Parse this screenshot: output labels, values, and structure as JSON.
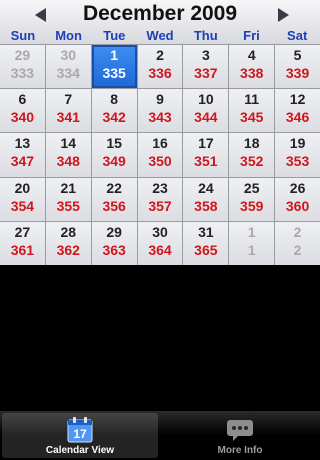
{
  "header": {
    "title": "December 2009",
    "prev_icon": "triangle-left",
    "next_icon": "triangle-right"
  },
  "weekdays": [
    "Sun",
    "Mon",
    "Tue",
    "Wed",
    "Thu",
    "Fri",
    "Sat"
  ],
  "weeks": [
    [
      {
        "day": "29",
        "doy": "333",
        "other": true
      },
      {
        "day": "30",
        "doy": "334",
        "other": true
      },
      {
        "day": "1",
        "doy": "335",
        "today": true
      },
      {
        "day": "2",
        "doy": "336"
      },
      {
        "day": "3",
        "doy": "337"
      },
      {
        "day": "4",
        "doy": "338"
      },
      {
        "day": "5",
        "doy": "339"
      }
    ],
    [
      {
        "day": "6",
        "doy": "340"
      },
      {
        "day": "7",
        "doy": "341"
      },
      {
        "day": "8",
        "doy": "342"
      },
      {
        "day": "9",
        "doy": "343"
      },
      {
        "day": "10",
        "doy": "344"
      },
      {
        "day": "11",
        "doy": "345"
      },
      {
        "day": "12",
        "doy": "346"
      }
    ],
    [
      {
        "day": "13",
        "doy": "347"
      },
      {
        "day": "14",
        "doy": "348"
      },
      {
        "day": "15",
        "doy": "349"
      },
      {
        "day": "16",
        "doy": "350"
      },
      {
        "day": "17",
        "doy": "351"
      },
      {
        "day": "18",
        "doy": "352"
      },
      {
        "day": "19",
        "doy": "353"
      }
    ],
    [
      {
        "day": "20",
        "doy": "354"
      },
      {
        "day": "21",
        "doy": "355"
      },
      {
        "day": "22",
        "doy": "356"
      },
      {
        "day": "23",
        "doy": "357"
      },
      {
        "day": "24",
        "doy": "358"
      },
      {
        "day": "25",
        "doy": "359"
      },
      {
        "day": "26",
        "doy": "360"
      }
    ],
    [
      {
        "day": "27",
        "doy": "361"
      },
      {
        "day": "28",
        "doy": "362"
      },
      {
        "day": "29",
        "doy": "363"
      },
      {
        "day": "30",
        "doy": "364"
      },
      {
        "day": "31",
        "doy": "365"
      },
      {
        "day": "1",
        "doy": "1",
        "other": true
      },
      {
        "day": "2",
        "doy": "2",
        "other": true
      }
    ]
  ],
  "tabbar": {
    "tabs": [
      {
        "label": "Calendar View",
        "icon": "calendar-icon",
        "icon_text": "17",
        "active": true
      },
      {
        "label": "More Info",
        "icon": "speech-bubble-icon"
      }
    ]
  },
  "colors": {
    "weekday_text": "#1d3fb8",
    "day_of_year_text": "#d0161c",
    "selected_cell": "#1e67d6"
  }
}
